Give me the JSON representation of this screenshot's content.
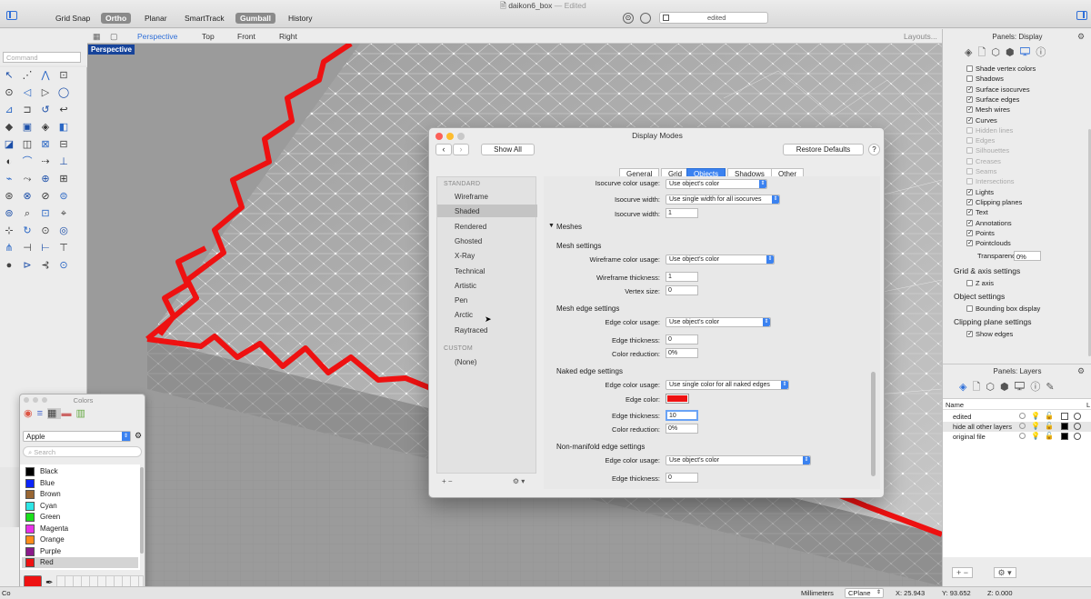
{
  "window": {
    "title": "daikon6_box",
    "status": "— Edited",
    "toolbar": [
      "Grid Snap",
      "Ortho",
      "Planar",
      "SmartTrack",
      "Gumball",
      "History"
    ],
    "toolbar_active": [
      "Ortho",
      "Gumball"
    ],
    "layer_field": "edited"
  },
  "view_tabs": {
    "items": [
      "Perspective",
      "Top",
      "Front",
      "Right"
    ],
    "active": "Perspective",
    "layouts": "Layouts..."
  },
  "viewport": {
    "label": "Perspective"
  },
  "command": {
    "placeholder": "Command"
  },
  "display_panel": {
    "title": "Panels: Display",
    "items": [
      {
        "label": "Shade vertex colors",
        "checked": false,
        "dim": false
      },
      {
        "label": "Shadows",
        "checked": false,
        "dim": false
      },
      {
        "label": "Surface isocurves",
        "checked": true,
        "dim": false
      },
      {
        "label": "Surface edges",
        "checked": true,
        "dim": false
      },
      {
        "label": "Mesh wires",
        "checked": true,
        "dim": false
      },
      {
        "label": "Curves",
        "checked": true,
        "dim": false
      },
      {
        "label": "Hidden lines",
        "checked": false,
        "dim": true
      },
      {
        "label": "Edges",
        "checked": false,
        "dim": true
      },
      {
        "label": "Silhouettes",
        "checked": false,
        "dim": true
      },
      {
        "label": "Creases",
        "checked": false,
        "dim": true
      },
      {
        "label": "Seams",
        "checked": false,
        "dim": true
      },
      {
        "label": "Intersections",
        "checked": false,
        "dim": true
      },
      {
        "label": "Lights",
        "checked": true,
        "dim": false
      },
      {
        "label": "Clipping planes",
        "checked": true,
        "dim": false
      },
      {
        "label": "Text",
        "checked": true,
        "dim": false
      },
      {
        "label": "Annotations",
        "checked": true,
        "dim": false
      },
      {
        "label": "Points",
        "checked": true,
        "dim": false
      },
      {
        "label": "Pointclouds",
        "checked": true,
        "dim": false
      }
    ],
    "transparency_label": "Transparency:",
    "transparency_value": "0%",
    "grid_heading": "Grid & axis settings",
    "zaxis": "Z axis",
    "object_heading": "Object settings",
    "bbox": "Bounding box display",
    "clip_heading": "Clipping plane settings",
    "show_edges": "Show edges"
  },
  "layers_panel": {
    "title": "Panels: Layers",
    "col_name": "Name",
    "col_extra": "L",
    "rows": [
      {
        "name": "edited",
        "color": "#ffffff"
      },
      {
        "name": "hide all other layers",
        "color": "#000000"
      },
      {
        "name": "original file",
        "color": "#000000"
      }
    ]
  },
  "dialog": {
    "title": "Display Modes",
    "show_all": "Show All",
    "restore": "Restore Defaults",
    "help": "?",
    "tabs": [
      "General",
      "Grid",
      "Objects",
      "Shadows",
      "Other"
    ],
    "active_tab": "Objects",
    "standard_heading": "STANDARD",
    "modes": [
      "Wireframe",
      "Shaded",
      "Rendered",
      "Ghosted",
      "X-Ray",
      "Technical",
      "Artistic",
      "Pen",
      "Arctic",
      "Raytraced"
    ],
    "selected_mode": "Shaded",
    "custom_heading": "CUSTOM",
    "custom_modes": [
      "(None)"
    ],
    "settings": {
      "iso_color_label": "Isocurve color usage:",
      "iso_color_value": "Use object's color",
      "iso_width_label": "Isocurve width:",
      "iso_width_value": "Use single width for all isocurves",
      "iso_width_num_label": "Isocurve width:",
      "iso_width_num": "1",
      "meshes_heading": "Meshes",
      "mesh_settings": "Mesh settings",
      "wire_color_label": "Wireframe color usage:",
      "wire_color_value": "Use object's color",
      "wire_thick_label": "Wireframe thickness:",
      "wire_thick": "1",
      "vertex_label": "Vertex size:",
      "vertex": "0",
      "edge_settings": "Mesh edge settings",
      "edge_color_label": "Edge color usage:",
      "edge_color_value": "Use object's color",
      "edge_thick_label": "Edge thickness:",
      "edge_thick": "0",
      "color_red_label": "Color reduction:",
      "color_red": "0%",
      "naked_settings": "Naked edge settings",
      "naked_color_label": "Edge color usage:",
      "naked_color_value": "Use single color for all naked edges",
      "naked_edgecolor_label": "Edge color:",
      "naked_edgecolor": "#ee1111",
      "naked_thick_label": "Edge thickness:",
      "naked_thick": "10",
      "naked_red_label": "Color reduction:",
      "naked_red": "0%",
      "nonmani_settings": "Non-manifold edge settings",
      "nm_color_label": "Edge color usage:",
      "nm_color_value": "Use object's color",
      "nm_thick_label": "Edge thickness:",
      "nm_thick": "0"
    }
  },
  "colors_panel": {
    "title": "Colors",
    "palette": "Apple",
    "search_placeholder": "Search",
    "items": [
      {
        "name": "Black",
        "color": "#000000"
      },
      {
        "name": "Blue",
        "color": "#0b24fb"
      },
      {
        "name": "Brown",
        "color": "#996633"
      },
      {
        "name": "Cyan",
        "color": "#2ee6e6"
      },
      {
        "name": "Green",
        "color": "#1be01b"
      },
      {
        "name": "Magenta",
        "color": "#e832e8"
      },
      {
        "name": "Orange",
        "color": "#ff8c1a"
      },
      {
        "name": "Purple",
        "color": "#8a1a8a"
      },
      {
        "name": "Red",
        "color": "#ee1111"
      }
    ],
    "selected": "Red",
    "current_color": "#ee1111"
  },
  "status": {
    "units": "Millimeters",
    "cplane": "CPlane",
    "x": "X: 25.943",
    "y": "Y: 93.652",
    "z": "Z: 0.000",
    "left_text": "Co"
  }
}
